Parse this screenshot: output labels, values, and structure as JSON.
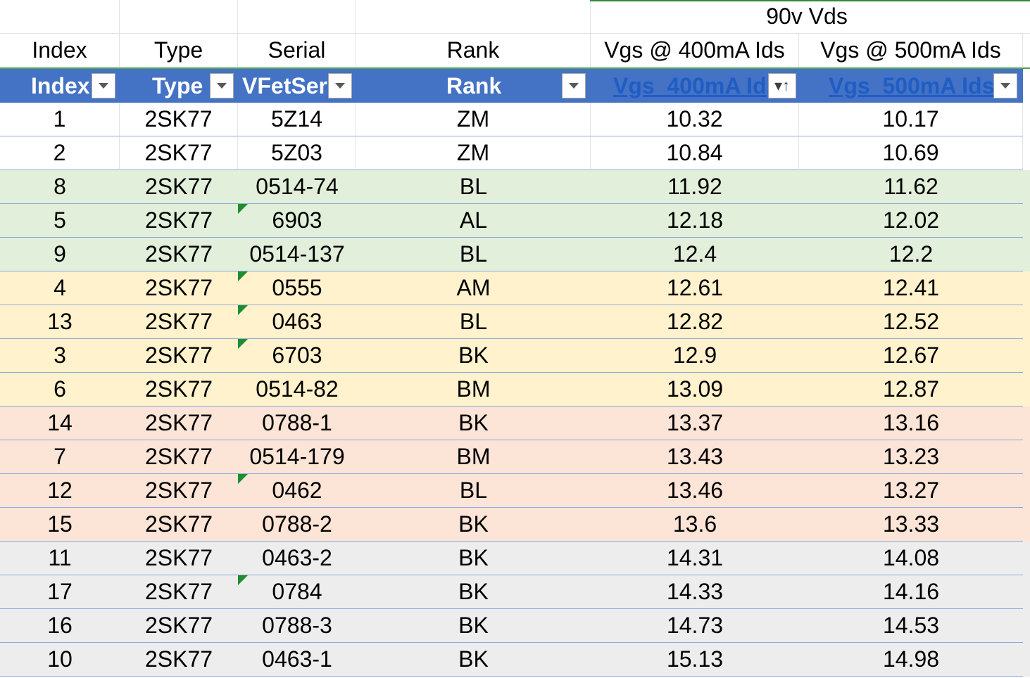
{
  "title_row": {
    "group_label": "90v Vds"
  },
  "header_row": {
    "index": "Index",
    "type": "Type",
    "serial": "Serial",
    "rank": "Rank",
    "vgs400": "Vgs @ 400mA Ids",
    "vgs500": "Vgs @ 500mA Ids"
  },
  "filter_row": {
    "index": "Index",
    "type": "Type",
    "serial": "VFetSer",
    "rank": "Rank",
    "vgs400": "Vgs_400mA Id",
    "vgs500": "Vgs_500mA Ids"
  },
  "colors": {
    "header_blue": "#4472c4",
    "green": "#e2efda",
    "yellow": "#fff2cc",
    "salmon": "#fce4d6",
    "gray": "#ededed",
    "white": "#ffffff"
  },
  "rows": [
    {
      "index": "1",
      "type": "2SK77",
      "serial": "5Z14",
      "rank": "ZM",
      "vgs400": "10.32",
      "vgs500": "10.17",
      "band": "white",
      "flag": false
    },
    {
      "index": "2",
      "type": "2SK77",
      "serial": "5Z03",
      "rank": "ZM",
      "vgs400": "10.84",
      "vgs500": "10.69",
      "band": "white",
      "flag": false
    },
    {
      "index": "8",
      "type": "2SK77",
      "serial": "0514-74",
      "rank": "BL",
      "vgs400": "11.92",
      "vgs500": "11.62",
      "band": "green",
      "flag": false
    },
    {
      "index": "5",
      "type": "2SK77",
      "serial": "6903",
      "rank": "AL",
      "vgs400": "12.18",
      "vgs500": "12.02",
      "band": "green",
      "flag": true
    },
    {
      "index": "9",
      "type": "2SK77",
      "serial": "0514-137",
      "rank": "BL",
      "vgs400": "12.4",
      "vgs500": "12.2",
      "band": "green",
      "flag": false
    },
    {
      "index": "4",
      "type": "2SK77",
      "serial": "0555",
      "rank": "AM",
      "vgs400": "12.61",
      "vgs500": "12.41",
      "band": "yellow",
      "flag": true
    },
    {
      "index": "13",
      "type": "2SK77",
      "serial": "0463",
      "rank": "BL",
      "vgs400": "12.82",
      "vgs500": "12.52",
      "band": "yellow",
      "flag": true
    },
    {
      "index": "3",
      "type": "2SK77",
      "serial": "6703",
      "rank": "BK",
      "vgs400": "12.9",
      "vgs500": "12.67",
      "band": "yellow",
      "flag": true
    },
    {
      "index": "6",
      "type": "2SK77",
      "serial": "0514-82",
      "rank": "BM",
      "vgs400": "13.09",
      "vgs500": "12.87",
      "band": "yellow",
      "flag": false
    },
    {
      "index": "14",
      "type": "2SK77",
      "serial": "0788-1",
      "rank": "BK",
      "vgs400": "13.37",
      "vgs500": "13.16",
      "band": "salmon",
      "flag": false
    },
    {
      "index": "7",
      "type": "2SK77",
      "serial": "0514-179",
      "rank": "BM",
      "vgs400": "13.43",
      "vgs500": "13.23",
      "band": "salmon",
      "flag": false
    },
    {
      "index": "12",
      "type": "2SK77",
      "serial": "0462",
      "rank": "BL",
      "vgs400": "13.46",
      "vgs500": "13.27",
      "band": "salmon",
      "flag": true
    },
    {
      "index": "15",
      "type": "2SK77",
      "serial": "0788-2",
      "rank": "BK",
      "vgs400": "13.6",
      "vgs500": "13.33",
      "band": "salmon",
      "flag": false
    },
    {
      "index": "11",
      "type": "2SK77",
      "serial": "0463-2",
      "rank": "BK",
      "vgs400": "14.31",
      "vgs500": "14.08",
      "band": "gray",
      "flag": false
    },
    {
      "index": "17",
      "type": "2SK77",
      "serial": "0784",
      "rank": "BK",
      "vgs400": "14.33",
      "vgs500": "14.16",
      "band": "gray",
      "flag": true
    },
    {
      "index": "16",
      "type": "2SK77",
      "serial": "0788-3",
      "rank": "BK",
      "vgs400": "14.73",
      "vgs500": "14.53",
      "band": "gray",
      "flag": false
    },
    {
      "index": "10",
      "type": "2SK77",
      "serial": "0463-1",
      "rank": "BK",
      "vgs400": "15.13",
      "vgs500": "14.98",
      "band": "gray",
      "flag": false
    }
  ]
}
